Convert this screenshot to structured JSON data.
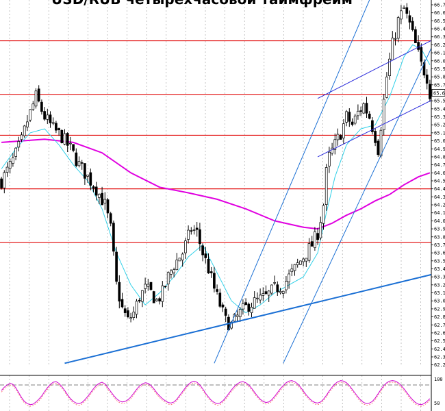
{
  "chart_data": {
    "type": "candlestick",
    "title": "USD/RUB четырехчасовой таймфрейм",
    "timeframe": "H4",
    "y_ticks": [
      62.2,
      62.3,
      62.4,
      62.5,
      62.6,
      62.7,
      62.8,
      62.9,
      63.0,
      63.1,
      63.2,
      63.3,
      63.4,
      63.5,
      63.6,
      63.7,
      63.8,
      63.9,
      64.0,
      64.1,
      64.2,
      64.3,
      64.4,
      64.5,
      64.6,
      64.7,
      64.8,
      64.9,
      65.0,
      65.1,
      65.2,
      65.3,
      65.4,
      65.5,
      65.6,
      65.7,
      65.8,
      65.9,
      66.0,
      66.1,
      66.2,
      66.3,
      66.4,
      66.5,
      66.6,
      66.7
    ],
    "ylim": [
      62.18,
      66.76
    ],
    "current_price_label": "65.6",
    "bar_count": 150,
    "close_path": [
      [
        0,
        64.5
      ],
      [
        4,
        64.75
      ],
      [
        7,
        65.0
      ],
      [
        9,
        65.25
      ],
      [
        12,
        65.55
      ],
      [
        15,
        65.3
      ],
      [
        18,
        65.15
      ],
      [
        21,
        65.05
      ],
      [
        24,
        64.9
      ],
      [
        27,
        64.7
      ],
      [
        30,
        64.55
      ],
      [
        33,
        64.4
      ],
      [
        36,
        64.2
      ],
      [
        38,
        63.9
      ],
      [
        40,
        63.2
      ],
      [
        42,
        62.9
      ],
      [
        44,
        62.75
      ],
      [
        46,
        62.85
      ],
      [
        48,
        63.05
      ],
      [
        50,
        63.15
      ],
      [
        52,
        63.1
      ],
      [
        54,
        63.0
      ],
      [
        56,
        63.1
      ],
      [
        58,
        63.3
      ],
      [
        60,
        63.45
      ],
      [
        63,
        63.6
      ],
      [
        66,
        63.9
      ],
      [
        68,
        63.85
      ],
      [
        70,
        63.6
      ],
      [
        72,
        63.4
      ],
      [
        74,
        63.15
      ],
      [
        76,
        62.95
      ],
      [
        78,
        62.75
      ],
      [
        80,
        62.7
      ],
      [
        83,
        62.85
      ],
      [
        86,
        62.95
      ],
      [
        89,
        63.0
      ],
      [
        92,
        63.05
      ],
      [
        95,
        63.15
      ],
      [
        98,
        63.2
      ],
      [
        100,
        63.3
      ],
      [
        102,
        63.4
      ],
      [
        104,
        63.5
      ],
      [
        106,
        63.6
      ],
      [
        108,
        63.7
      ],
      [
        110,
        63.85
      ],
      [
        112,
        64.2
      ],
      [
        113,
        64.6
      ],
      [
        114,
        64.8
      ],
      [
        116,
        64.95
      ],
      [
        118,
        65.1
      ],
      [
        120,
        65.3
      ],
      [
        122,
        65.2
      ],
      [
        124,
        65.35
      ],
      [
        126,
        65.45
      ],
      [
        128,
        65.3
      ],
      [
        130,
        65.05
      ],
      [
        131,
        64.9
      ],
      [
        132,
        65.2
      ],
      [
        134,
        65.8
      ],
      [
        136,
        66.2
      ],
      [
        138,
        66.5
      ],
      [
        140,
        66.65
      ],
      [
        142,
        66.45
      ],
      [
        144,
        66.2
      ],
      [
        146,
        65.95
      ],
      [
        148,
        65.8
      ],
      [
        149,
        65.6
      ]
    ],
    "indicators": {
      "slow_ma": [
        [
          0,
          64.98
        ],
        [
          15,
          65.02
        ],
        [
          25,
          64.98
        ],
        [
          35,
          64.85
        ],
        [
          45,
          64.6
        ],
        [
          55,
          64.42
        ],
        [
          65,
          64.35
        ],
        [
          75,
          64.27
        ],
        [
          85,
          64.15
        ],
        [
          95,
          64.0
        ],
        [
          105,
          63.92
        ],
        [
          110,
          63.9
        ],
        [
          115,
          63.97
        ],
        [
          120,
          64.07
        ],
        [
          125,
          64.15
        ],
        [
          130,
          64.25
        ],
        [
          135,
          64.33
        ],
        [
          140,
          64.45
        ],
        [
          145,
          64.55
        ],
        [
          150,
          64.6
        ]
      ],
      "fast_ma": [
        [
          0,
          64.65
        ],
        [
          5,
          64.9
        ],
        [
          10,
          65.1
        ],
        [
          15,
          65.15
        ],
        [
          20,
          64.95
        ],
        [
          25,
          64.7
        ],
        [
          30,
          64.5
        ],
        [
          35,
          64.15
        ],
        [
          40,
          63.6
        ],
        [
          45,
          63.2
        ],
        [
          50,
          62.95
        ],
        [
          55,
          63.1
        ],
        [
          60,
          63.3
        ],
        [
          65,
          63.55
        ],
        [
          70,
          63.7
        ],
        [
          75,
          63.35
        ],
        [
          80,
          63.0
        ],
        [
          85,
          62.85
        ],
        [
          90,
          62.95
        ],
        [
          95,
          63.1
        ],
        [
          100,
          63.2
        ],
        [
          105,
          63.3
        ],
        [
          110,
          63.6
        ],
        [
          113,
          64.1
        ],
        [
          116,
          64.55
        ],
        [
          120,
          64.95
        ],
        [
          125,
          65.15
        ],
        [
          130,
          65.2
        ],
        [
          135,
          65.55
        ],
        [
          140,
          66.05
        ],
        [
          143,
          66.2
        ],
        [
          146,
          66.15
        ],
        [
          150,
          65.95
        ]
      ]
    },
    "horizontal_levels": [
      66.25,
      65.58,
      65.07,
      64.4,
      63.73
    ],
    "trendlines": [
      {
        "from": [
          22,
          62.22
        ],
        "to": [
          152,
          63.35
        ],
        "color": "#1a6fd4",
        "width": 2
      },
      {
        "from": [
          74,
          62.22
        ],
        "to": [
          128,
          66.76
        ],
        "color": "#1a6fd4",
        "width": 1
      },
      {
        "from": [
          98,
          62.22
        ],
        "to": [
          152,
          66.35
        ],
        "color": "#1a6fd4",
        "width": 1
      },
      {
        "from": [
          110,
          65.53
        ],
        "to": [
          152,
          66.3
        ],
        "color": "#2b2bdc",
        "width": 1
      },
      {
        "from": [
          110,
          64.8
        ],
        "to": [
          152,
          65.55
        ],
        "color": "#2b2bdc",
        "width": 1
      }
    ],
    "oscillator": {
      "ticks": [
        "100",
        "50"
      ],
      "levels": [
        80,
        50
      ],
      "values": [
        60,
        72,
        80,
        86,
        82,
        70,
        52,
        34,
        20,
        12,
        8,
        10,
        18,
        28,
        40,
        56,
        70,
        82,
        90,
        92,
        86,
        74,
        60,
        44,
        30,
        20,
        14,
        12,
        16,
        26,
        38,
        52,
        66,
        78,
        86,
        90,
        84,
        70,
        56,
        42,
        30,
        22,
        18,
        20,
        26,
        36,
        50,
        64,
        76,
        84,
        88,
        86,
        78,
        66,
        52,
        40,
        30,
        22,
        16,
        14,
        18,
        28,
        42,
        56,
        70,
        82,
        90,
        94,
        90,
        80,
        66,
        50,
        36,
        24,
        16,
        12,
        14,
        22,
        34,
        48,
        62,
        74,
        84,
        90,
        92,
        88,
        80,
        68,
        54,
        40,
        28,
        20,
        16,
        18,
        26,
        38,
        52,
        66,
        78,
        88,
        94,
        96,
        92,
        84,
        72,
        58,
        44,
        32,
        22,
        16,
        14,
        18,
        28,
        42,
        58,
        72,
        84,
        92,
        96,
        94,
        88,
        78,
        64,
        50,
        36,
        24,
        16,
        12,
        14,
        20,
        32,
        48,
        64,
        78,
        88,
        94,
        96,
        94,
        88,
        78,
        66,
        52,
        38,
        26,
        16,
        10,
        8,
        12,
        20,
        30
      ]
    }
  }
}
